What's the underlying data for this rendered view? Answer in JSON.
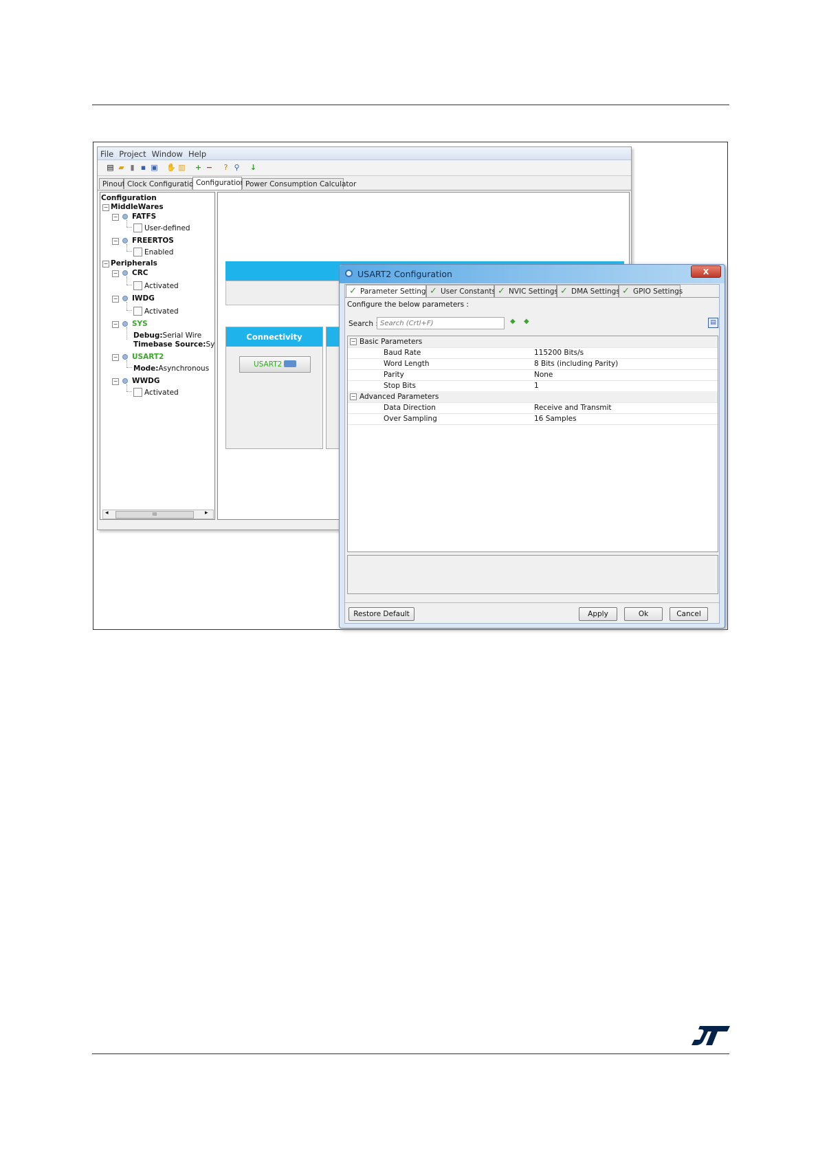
{
  "app": {
    "menu": [
      "File",
      "Project",
      "Window",
      "Help"
    ],
    "tabs": [
      "Pinout",
      "Clock Configuration",
      "Configuration",
      "Power Consumption Calculator"
    ],
    "active_tab": "Configuration",
    "tree": {
      "root": "Configuration",
      "middlewares": "MiddleWares",
      "fatfs": "FATFS",
      "fatfs_option": "User-defined",
      "freertos": "FREERTOS",
      "freertos_option": "Enabled",
      "peripherals": "Peripherals",
      "crc": "CRC",
      "crc_option": "Activated",
      "iwdg": "IWDG",
      "iwdg_option": "Activated",
      "sys": "SYS",
      "sys_debug_label": "Debug:",
      "sys_debug_value": "Serial Wire",
      "sys_timebase_label": "Timebase Source:",
      "sys_timebase_value": "Sys",
      "usart2": "USART2",
      "usart2_mode_label": "Mode:",
      "usart2_mode_value": "Asynchronous",
      "wwdg": "WWDG",
      "wwdg_option": "Activated",
      "scroll_thumb": "III"
    },
    "connectivity": {
      "header": "Connectivity",
      "usart2_button": "USART2"
    }
  },
  "dialog": {
    "title": "USART2 Configuration",
    "close": "X",
    "tabs": [
      "Parameter Settings",
      "User Constants",
      "NVIC Settings",
      "DMA Settings",
      "GPIO Settings"
    ],
    "instruction": "Configure the below parameters :",
    "search_label": "Search :",
    "search_placeholder": "Search (Crtl+F)",
    "basic_group": "Basic Parameters",
    "basic_params": [
      {
        "name": "Baud Rate",
        "value": "115200 Bits/s"
      },
      {
        "name": "Word Length",
        "value": "8 Bits (including Parity)"
      },
      {
        "name": "Parity",
        "value": "None"
      },
      {
        "name": "Stop Bits",
        "value": "1"
      }
    ],
    "advanced_group": "Advanced Parameters",
    "advanced_params": [
      {
        "name": "Data Direction",
        "value": "Receive and Transmit"
      },
      {
        "name": "Over Sampling",
        "value": "16 Samples"
      }
    ],
    "buttons": {
      "restore": "Restore Default",
      "apply": "Apply",
      "ok": "Ok",
      "cancel": "Cancel"
    }
  },
  "colors": {
    "accent_blue": "#1fb3ec",
    "green": "#3aa62a",
    "st_logo_blue": "#03234b"
  }
}
